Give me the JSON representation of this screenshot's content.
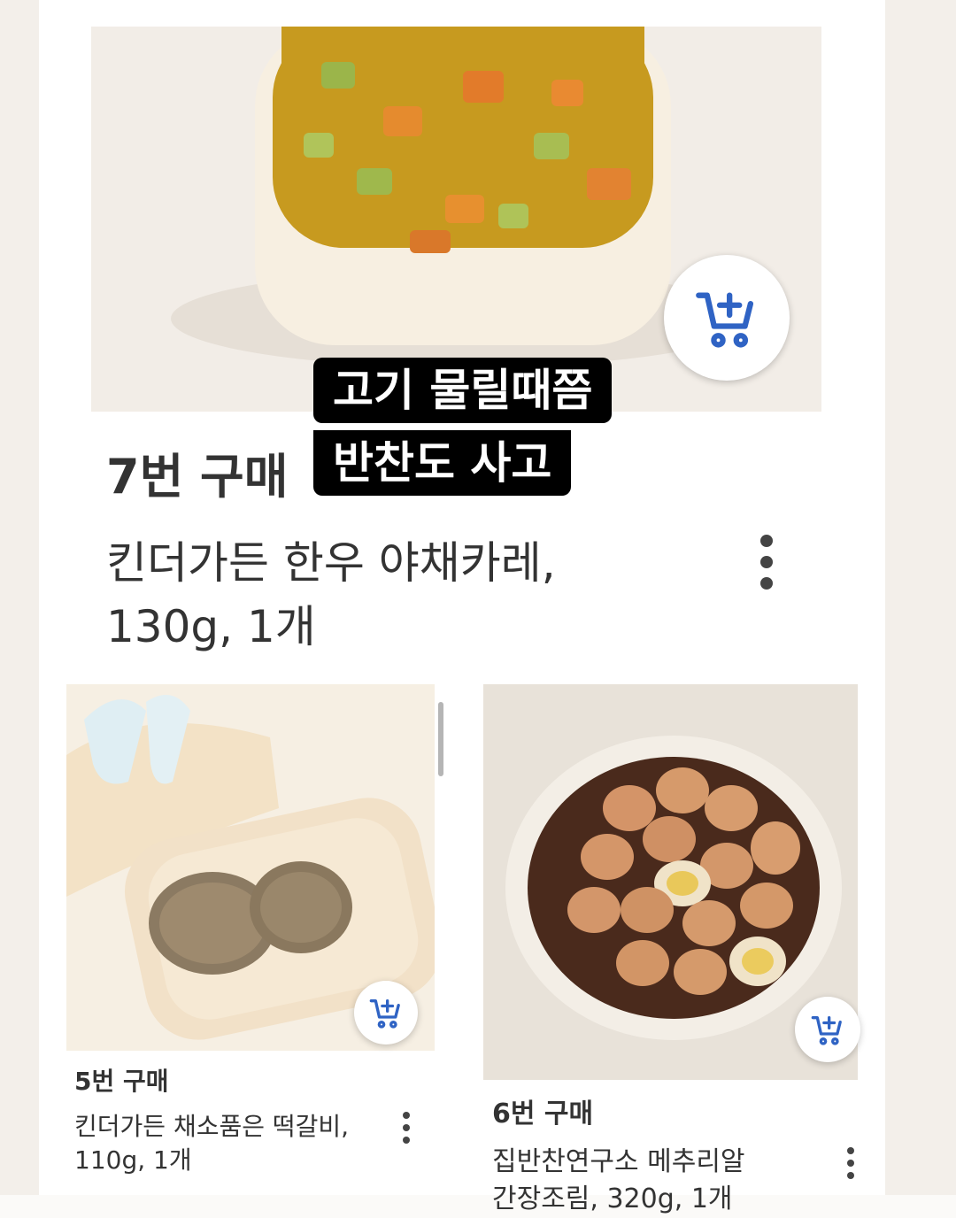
{
  "overlay": {
    "caption_line1": "고기 물릴때쯤",
    "caption_line2": "반찬도 사고"
  },
  "products": [
    {
      "rank": "7번 구매",
      "title_line1": "킨더가든 한우 야채카레,",
      "title_line2": "130g, 1개"
    },
    {
      "rank": "5번 구매",
      "title_line1": "킨더가든 채소품은 떡갈비,",
      "title_line2": "110g, 1개"
    },
    {
      "rank": "6번 구매",
      "title_line1": "집반찬연구소 메추리알",
      "title_line2": "간장조림, 320g, 1개"
    }
  ],
  "icons": {
    "cart": "add-to-cart-icon",
    "more": "more-vertical-icon"
  },
  "colors": {
    "accent": "#2f63c4",
    "caption_bg": "#000000",
    "caption_text": "#ffffff"
  }
}
